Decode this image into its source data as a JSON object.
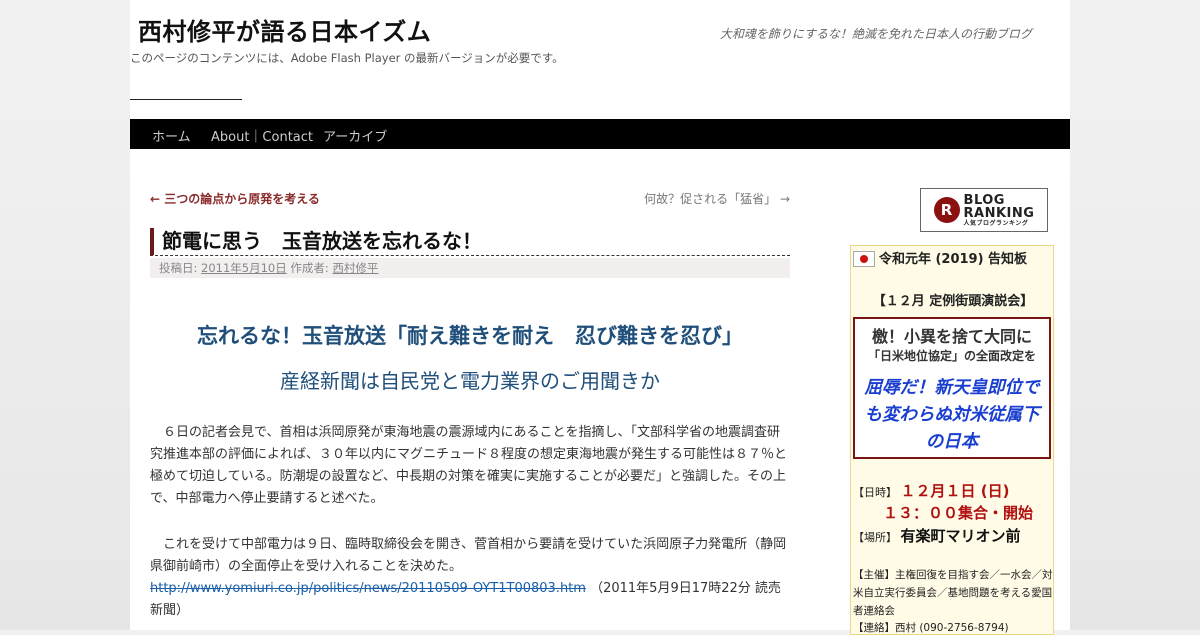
{
  "header": {
    "site_title": "西村修平が語る日本イズム",
    "site_description": "大和魂を飾りにするな！絶滅を免れた日本人の行動ブログ",
    "flash_note": "このページのコンテンツには、Adobe Flash Player の最新バージョンが必要です。"
  },
  "nav": {
    "items": [
      "ホーム",
      "About｜Contact",
      "アーカイブ"
    ]
  },
  "post": {
    "prev_link": "← 三つの論点から原発を考える",
    "next_link": "何故？促される「猛省」 →",
    "title": "節電に思う　玉音放送を忘れるな！",
    "meta_posted_label": "投稿日:",
    "meta_date": "2011年5月10日",
    "meta_author_label": "作成者:",
    "meta_author": "西村修平",
    "lead1": "忘れるな！玉音放送「耐え難きを耐え　忍び難きを忍び」",
    "lead2": "産経新聞は自民党と電力業界のご用聞きか",
    "para1": "　６日の記者会見で、首相は浜岡原発が東海地震の震源域内にあることを指摘し、「文部科学省の地震調査研究推進本部の評価によれば、３０年以内にマグニチュード８程度の想定東海地震が発生する可能性は８７％と極めて切迫している。防潮堤の設置など、中長期の対策を確実に実施することが必要だ」と強調した。その上で、中部電力へ停止要請すると述べた。",
    "para2": "　これを受けて中部電力は９日、臨時取締役会を開き、菅首相から要請を受けていた浜岡原子力発電所（静岡県御前崎市）の全面停止を受け入れることを決めた。",
    "source_link": "http://www.yomiuri.co.jp/politics/news/20110509-OYT1T00803.htm",
    "source_note": "（2011年5月9日17時22分 読売新聞）"
  },
  "sidebar": {
    "blog_ranking_badge": "R",
    "blog_ranking_line1": "BLOG",
    "blog_ranking_line2": "RANKING",
    "blog_ranking_small": "人気ブログランキング",
    "notice_title": "令和元年 (2019) 告知板",
    "notice_sub": "【１２月 定例街頭演説会】",
    "speech_line1": "檄！小異を捨て大同に",
    "speech_line2": "「日米地位協定」の全面改定を",
    "speech_line3": "屈辱だ！新天皇即位でも変わらぬ対米従属下の日本",
    "date_label": "【日時】",
    "date_value": "１２月１日 (日)",
    "time_value": "１３：００集合・開始",
    "place_label": "【場所】",
    "place_value": "有楽町マリオン前",
    "organizer": "【主催】主権回復を目指す会／一水会／対米自立実行委員会／基地問題を考える愛国者連絡会",
    "contact": "【連絡】西村 (090-2756-8794)"
  },
  "colors": {
    "nav_bg": "#000000",
    "accent_dark_red": "#6b1a1a",
    "lead_blue": "#1f4f7a",
    "speech_blue": "#1a3fd0",
    "date_red": "#b01010"
  }
}
